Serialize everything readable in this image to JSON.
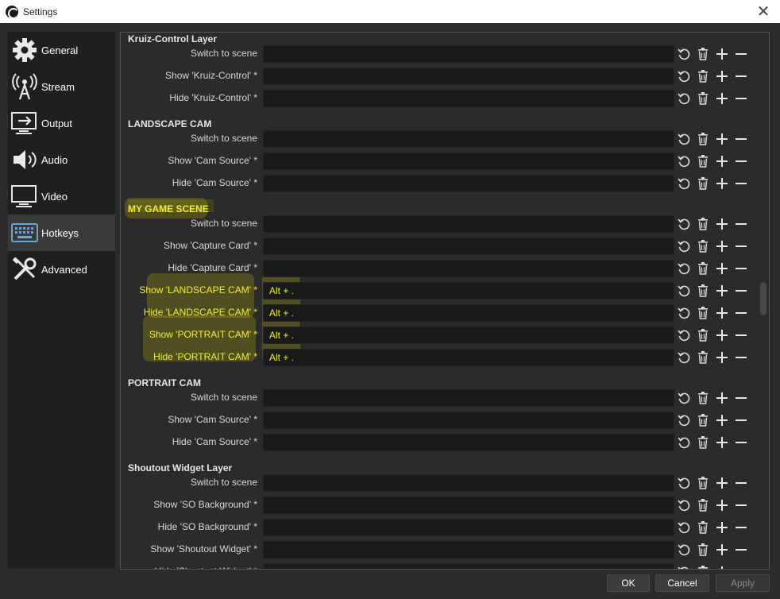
{
  "window": {
    "title": "Settings"
  },
  "sidebar": {
    "items": [
      {
        "label": "General",
        "icon": "gear-icon"
      },
      {
        "label": "Stream",
        "icon": "broadcast-icon"
      },
      {
        "label": "Output",
        "icon": "output-icon"
      },
      {
        "label": "Audio",
        "icon": "speaker-icon"
      },
      {
        "label": "Video",
        "icon": "monitor-icon"
      },
      {
        "label": "Hotkeys",
        "icon": "keyboard-icon",
        "active": true
      },
      {
        "label": "Advanced",
        "icon": "tools-icon"
      }
    ]
  },
  "groups": [
    {
      "title": "Kruiz-Control Layer",
      "rows": [
        {
          "label": "Switch to scene",
          "value": ""
        },
        {
          "label": "Show 'Kruiz-Control' *",
          "value": ""
        },
        {
          "label": "Hide 'Kruiz-Control' *",
          "value": ""
        }
      ]
    },
    {
      "title": "LANDSCAPE CAM",
      "rows": [
        {
          "label": "Switch to scene",
          "value": ""
        },
        {
          "label": "Show 'Cam Source' *",
          "value": ""
        },
        {
          "label": "Hide 'Cam Source' *",
          "value": ""
        }
      ]
    },
    {
      "title": "MY GAME SCENE",
      "rows": [
        {
          "label": "Switch to scene",
          "value": ""
        },
        {
          "label": "Show 'Capture Card' *",
          "value": ""
        },
        {
          "label": "Hide 'Capture Card' *",
          "value": ""
        },
        {
          "label": "Show 'LANDSCAPE CAM' *",
          "value": "Alt + ."
        },
        {
          "label": "Hide 'LANDSCAPE CAM' *",
          "value": "Alt + ."
        },
        {
          "label": "Show 'PORTRAIT CAM' *",
          "value": "Alt + ."
        },
        {
          "label": "Hide 'PORTRAIT CAM' *",
          "value": "Alt + ."
        }
      ]
    },
    {
      "title": "PORTRAIT CAM",
      "rows": [
        {
          "label": "Switch to scene",
          "value": ""
        },
        {
          "label": "Show 'Cam Source' *",
          "value": ""
        },
        {
          "label": "Hide 'Cam Source' *",
          "value": ""
        }
      ]
    },
    {
      "title": "Shoutout Widget Layer",
      "rows": [
        {
          "label": "Switch to scene",
          "value": ""
        },
        {
          "label": "Show 'SO Background' *",
          "value": ""
        },
        {
          "label": "Hide 'SO Background' *",
          "value": ""
        },
        {
          "label": "Show 'Shoutout Widget' *",
          "value": ""
        },
        {
          "label": "Hide 'Shoutout Widget' *",
          "value": ""
        }
      ]
    }
  ],
  "row_buttons": {
    "revert": "revert-icon",
    "clear": "trash-icon",
    "add": "plus-icon",
    "remove": "minus-icon"
  },
  "footer": {
    "ok": "OK",
    "cancel": "Cancel",
    "apply": "Apply"
  },
  "colors": {
    "highlight": "#f0ec3a",
    "background": "#2b2b2b",
    "field": "#1a1a1a"
  }
}
